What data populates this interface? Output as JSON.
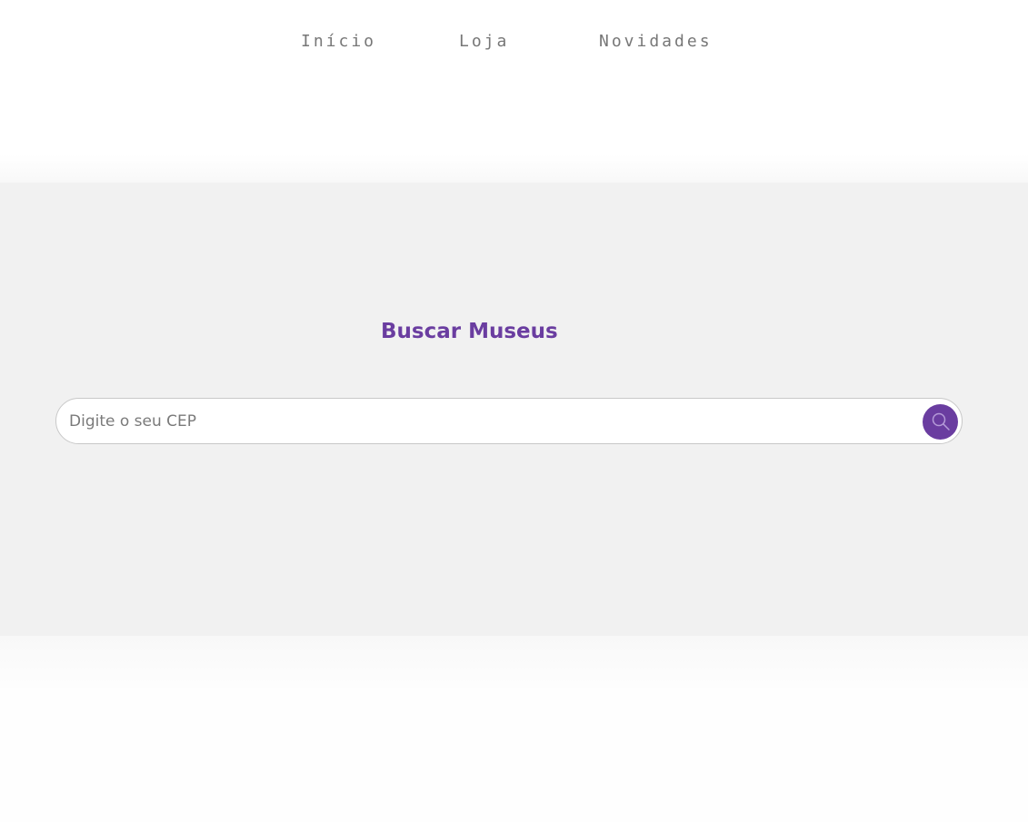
{
  "navigation": {
    "items": [
      {
        "label": "Início"
      },
      {
        "label": "Loja"
      },
      {
        "label": "Novidades"
      }
    ]
  },
  "search": {
    "title": "Buscar Museus",
    "input": {
      "value": "",
      "placeholder": "Digite o seu CEP"
    },
    "button": {
      "icon": "search-icon",
      "accent_color": "#6a3da0"
    }
  },
  "colors": {
    "nav_text": "#777777",
    "section_background": "#f1f1f1",
    "title": "#6a3da0",
    "input_border": "#c8c8c8",
    "placeholder": "#7a7a7a"
  }
}
